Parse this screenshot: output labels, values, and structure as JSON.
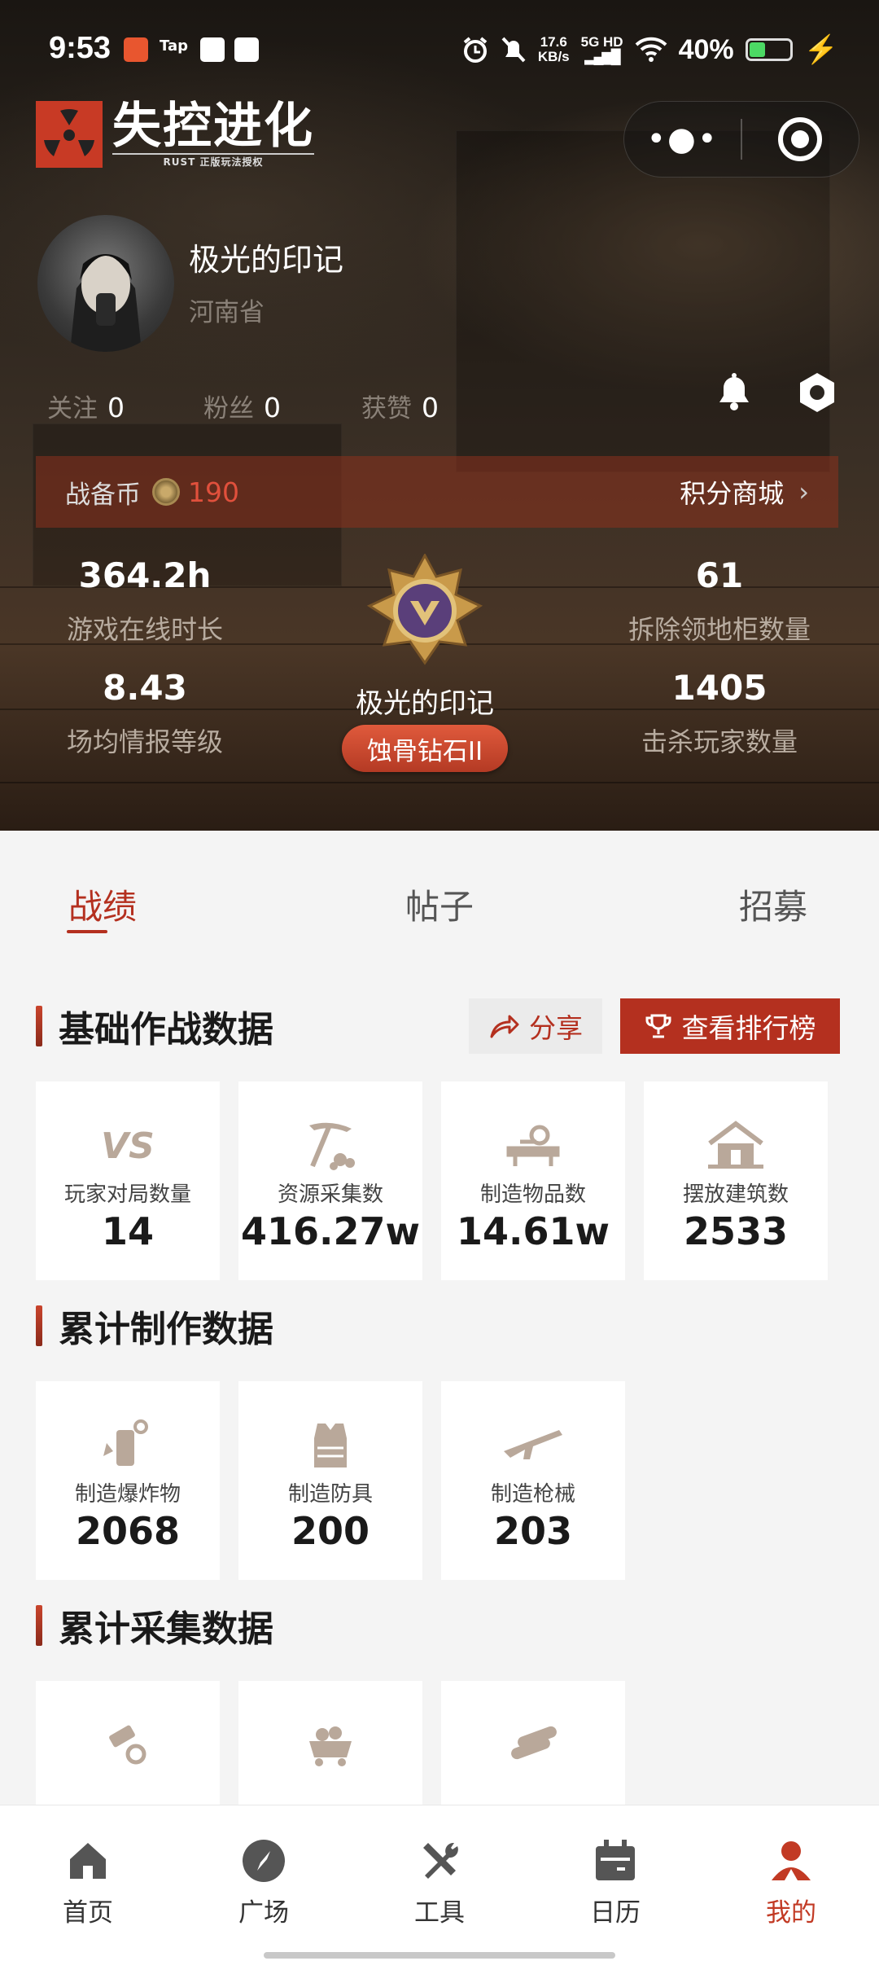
{
  "status_bar": {
    "time": "9:53",
    "net_speed_value": "17.6",
    "net_speed_unit": "KB/s",
    "network": "5G HD",
    "battery": "40%"
  },
  "app": {
    "logo_title": "失控进化",
    "logo_subtitle": "RUST 正版玩法授权"
  },
  "profile": {
    "username": "极光的印记",
    "province": "河南省",
    "follow_label": "关注",
    "follow_count": "0",
    "fans_label": "粉丝",
    "fans_count": "0",
    "likes_label": "获赞",
    "likes_count": "0"
  },
  "coins": {
    "label": "战备币",
    "value": "190",
    "shop_label": "积分商城"
  },
  "stats": {
    "online_hours": {
      "value": "364.2h",
      "label": "游戏在线时长"
    },
    "intel_level": {
      "value": "8.43",
      "label": "场均情报等级"
    },
    "cabinets_removed": {
      "value": "61",
      "label": "拆除领地柜数量"
    },
    "players_killed": {
      "value": "1405",
      "label": "击杀玩家数量"
    }
  },
  "rank": {
    "name": "极光的印记",
    "tier": "蚀骨钻石II"
  },
  "tabs": [
    "战绩",
    "帖子",
    "招募"
  ],
  "sections": {
    "basic": {
      "title": "基础作战数据",
      "share_label": "分享",
      "leaderboard_label": "查看排行榜",
      "cards": [
        {
          "icon": "vs-icon",
          "label": "玩家对局数量",
          "value": "14"
        },
        {
          "icon": "pickaxe-icon",
          "label": "资源采集数",
          "value": "416.27w"
        },
        {
          "icon": "crafting-icon",
          "label": "制造物品数",
          "value": "14.61w"
        },
        {
          "icon": "house-icon",
          "label": "摆放建筑数",
          "value": "2533"
        }
      ]
    },
    "crafting": {
      "title": "累计制作数据",
      "cards": [
        {
          "icon": "explosive-icon",
          "label": "制造爆炸物",
          "value": "2068"
        },
        {
          "icon": "armor-icon",
          "label": "制造防具",
          "value": "200"
        },
        {
          "icon": "rifle-icon",
          "label": "制造枪械",
          "value": "203"
        }
      ]
    },
    "gathering": {
      "title": "累计采集数据",
      "cards": [
        {
          "icon": "metal-icon"
        },
        {
          "icon": "ore-cart-icon"
        },
        {
          "icon": "wood-logs-icon"
        }
      ]
    }
  },
  "bottom_nav": [
    {
      "icon": "home-icon",
      "label": "首页"
    },
    {
      "icon": "compass-icon",
      "label": "广场"
    },
    {
      "icon": "tools-icon",
      "label": "工具"
    },
    {
      "icon": "calendar-icon",
      "label": "日历"
    },
    {
      "icon": "profile-icon",
      "label": "我的"
    }
  ],
  "colors": {
    "accent": "#b4301f",
    "coin_value": "#e0503c",
    "page_bg": "#f4f4f4"
  }
}
